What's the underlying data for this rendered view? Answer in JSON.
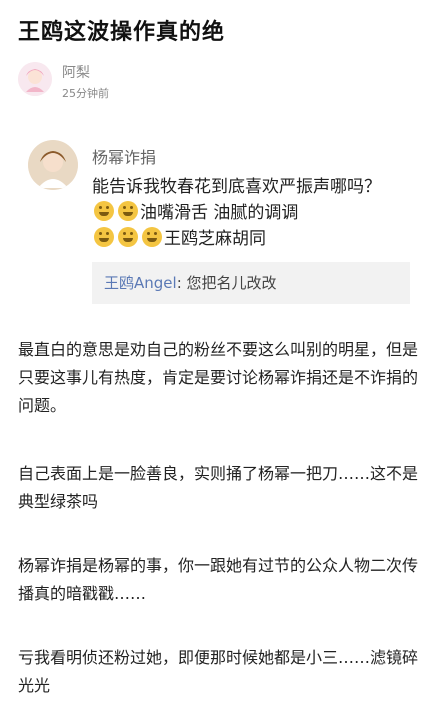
{
  "article": {
    "title": "王鸥这波操作真的绝",
    "author": "阿梨",
    "time": "25分钟前"
  },
  "quote": {
    "username": "杨幂诈捐",
    "text_part1": "能告诉我牧春花到底喜欢严振声哪吗？",
    "text_part2": "油嘴滑舌  油腻的调调",
    "text_part3": "王鸥芝麻胡同",
    "reply_name": "王鸥Angel",
    "reply_text": ": 您把名儿改改"
  },
  "paragraphs": [
    "最直白的意思是劝自己的粉丝不要这么叫别的明星，但是只要这事儿有热度，肯定是要讨论杨幂诈捐还是不诈捐的问题。",
    "自己表面上是一脸善良，实则捅了杨幂一把刀……这不是典型绿茶吗",
    "杨幂诈捐是杨幂的事，你一跟她有过节的公众人物二次传播真的暗戳戳……",
    "亏我看明侦还粉过她，即便那时候她都是小三……滤镜碎光光"
  ],
  "icons": {
    "emoji": "laughing-crying-emoji"
  }
}
